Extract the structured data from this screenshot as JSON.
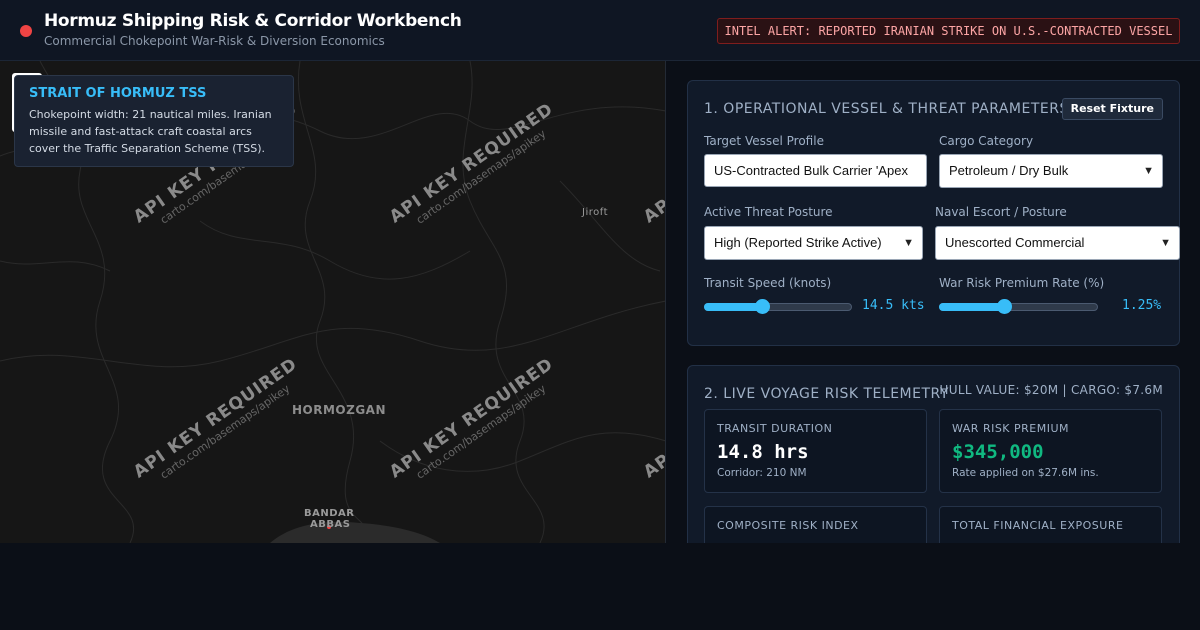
{
  "header": {
    "title": "Hormuz Shipping Risk & Corridor Workbench",
    "subtitle": "Commercial Chokepoint War-Risk & Diversion Economics",
    "alert": "INTEL ALERT: REPORTED IRANIAN STRIKE ON U.S.-CONTRACTED VESSEL"
  },
  "map": {
    "watermark": "API KEY REQUIRED",
    "watermark_sub": "carto.com/basemaps/apikey",
    "places": {
      "region": "HORMOZGAN",
      "city_line1": "BANDAR",
      "city_line2": "ABBAS",
      "town": "Jiroft"
    },
    "tss_card": {
      "title": "STRAIT OF HORMUZ TSS",
      "text": "Chokepoint width: 21 nautical miles. Iranian missile and fast-attack craft coastal arcs cover the Traffic Separation Scheme (TSS)."
    }
  },
  "params": {
    "title": "1. OPERATIONAL VESSEL & THREAT PARAMETERS",
    "reset_label": "Reset Fixture",
    "vessel_label": "Target Vessel Profile",
    "vessel_value": "US-Contracted Bulk Carrier 'Apex",
    "cargo_label": "Cargo Category",
    "cargo_value": "Petroleum / Dry Bulk",
    "threat_label": "Active Threat Posture",
    "threat_value": "High (Reported Strike Active)",
    "escort_label": "Naval Escort / Posture",
    "escort_value": "Unescorted Commercial",
    "speed_label": "Transit Speed (knots)",
    "speed_value": "14.5 kts",
    "speed_fraction": 0.39,
    "premium_label": "War Risk Premium Rate (%)",
    "premium_value": "1.25%",
    "premium_fraction": 0.41
  },
  "telemetry": {
    "title": "2. LIVE VOYAGE RISK TELEMETRY",
    "meta": "HULL VALUE: $20M | CARGO: $7.6M",
    "metrics": [
      {
        "label": "TRANSIT DURATION",
        "value": "14.8 hrs",
        "sub": "Corridor: 210 NM",
        "color": "#ffffff"
      },
      {
        "label": "WAR RISK PREMIUM",
        "value": "$345,000",
        "sub": "Rate applied on $27.6M ins.",
        "color": "#10b981"
      },
      {
        "label": "COMPOSITE RISK INDEX",
        "value": "",
        "sub": "",
        "color": "#ffffff"
      },
      {
        "label": "TOTAL FINANCIAL EXPOSURE",
        "value": "",
        "sub": "",
        "color": "#ffffff"
      }
    ]
  },
  "colors": {
    "accent": "#38bdf8",
    "alert": "#fca5a5",
    "premium": "#10b981",
    "status_dot": "#ef4444"
  }
}
